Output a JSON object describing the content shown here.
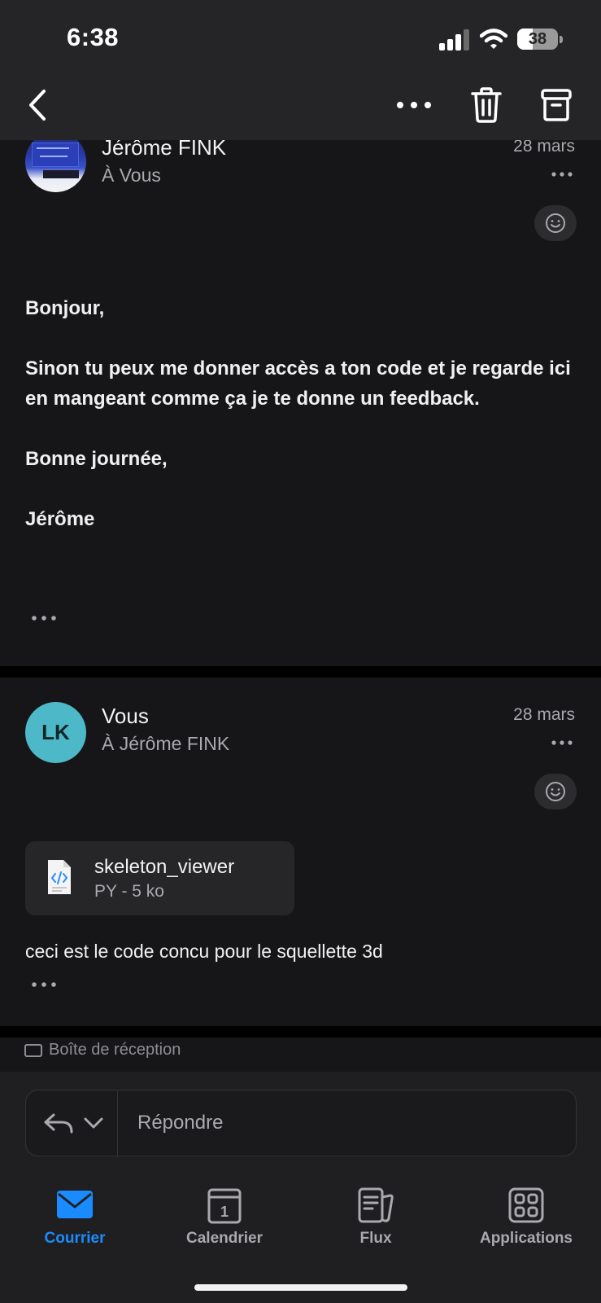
{
  "status_bar": {
    "time": "6:38",
    "battery": "38"
  },
  "messages": [
    {
      "sender": "Jérôme FINK",
      "recipient": "À Vous",
      "date": "28 mars",
      "body": [
        "Bonjour,",
        "Sinon tu peux me donner accès a ton code et je regarde ici en mangeant comme ça je te donne un feedback.",
        "Bonne journée,",
        "Jérôme"
      ]
    },
    {
      "sender": "Vous",
      "avatar_initials": "LK",
      "recipient": "À Jérôme FINK",
      "date": "28 mars",
      "attachment": {
        "name": "skeleton_viewer",
        "meta": "PY - 5 ko"
      },
      "body_text": "ceci est le code concu pour le squellette 3d"
    }
  ],
  "folder_peek": "Boîte de réception",
  "reply": {
    "placeholder": "Répondre"
  },
  "tabs": [
    {
      "label": "Courrier",
      "icon": "mail-icon",
      "active": true
    },
    {
      "label": "Calendrier",
      "icon": "calendar-icon",
      "calendar_day": "1"
    },
    {
      "label": "Flux",
      "icon": "feed-icon"
    },
    {
      "label": "Applications",
      "icon": "apps-grid-icon"
    }
  ],
  "colors": {
    "accent": "#1a8cff",
    "avatar_lk": "#4db9c8",
    "background": "#161618"
  }
}
